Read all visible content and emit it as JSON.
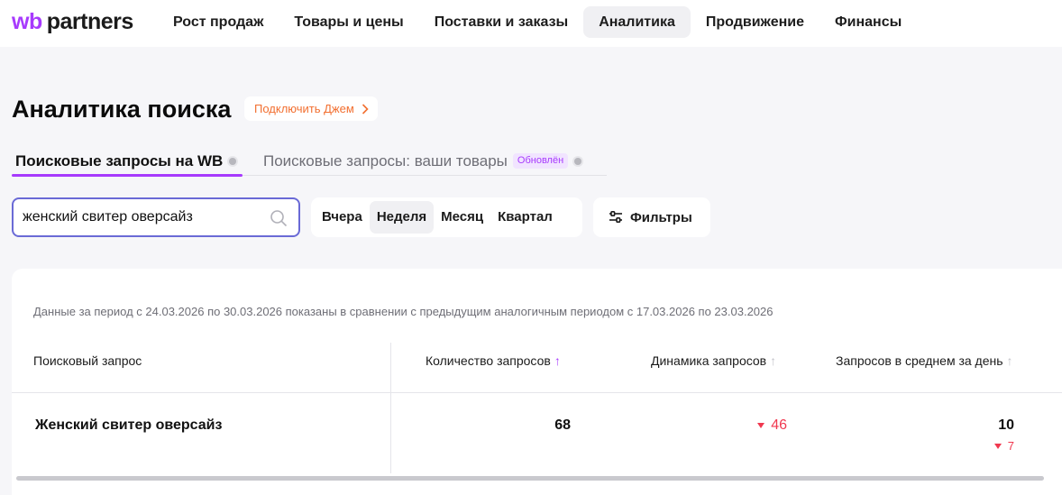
{
  "logo": {
    "part1": "wb",
    "part2": "partners"
  },
  "nav": [
    {
      "label": "Рост продаж"
    },
    {
      "label": "Товары и цены"
    },
    {
      "label": "Поставки и заказы"
    },
    {
      "label": "Аналитика"
    },
    {
      "label": "Продвижение"
    },
    {
      "label": "Финансы"
    }
  ],
  "nav_active": "Аналитика",
  "page": {
    "title": "Аналитика поиска",
    "jam_button": "Подключить Джем"
  },
  "tabs": {
    "tab1": "Поисковые запросы на WB",
    "tab2": "Поисковые запросы: ваши товары",
    "tab2_badge": "Обновлён"
  },
  "search": {
    "value": "женский свитер оверсайз",
    "icon": "search-icon"
  },
  "period": {
    "options": [
      "Вчера",
      "Неделя",
      "Месяц",
      "Квартал"
    ],
    "selected": "Неделя"
  },
  "filters": {
    "label": "Фильтры",
    "icon": "sliders-icon"
  },
  "table": {
    "note": "Данные за период с 24.03.2026 по 30.03.2026 показаны в сравнении с предыдущим аналогичным периодом с 17.03.2026 по 23.03.2026",
    "headers": {
      "query": "Поисковый запрос",
      "count": "Количество запросов",
      "dynamics": "Динамика запросов",
      "avg": "Запросов в среднем за день"
    },
    "rows": [
      {
        "query": "Женский свитер оверсайз",
        "count": "68",
        "dynamics": "46",
        "avg": "10",
        "avg_delta": "7"
      }
    ]
  },
  "colors": {
    "accent": "#a73afd",
    "negative": "#f0384f",
    "jam": "#f26f30"
  }
}
